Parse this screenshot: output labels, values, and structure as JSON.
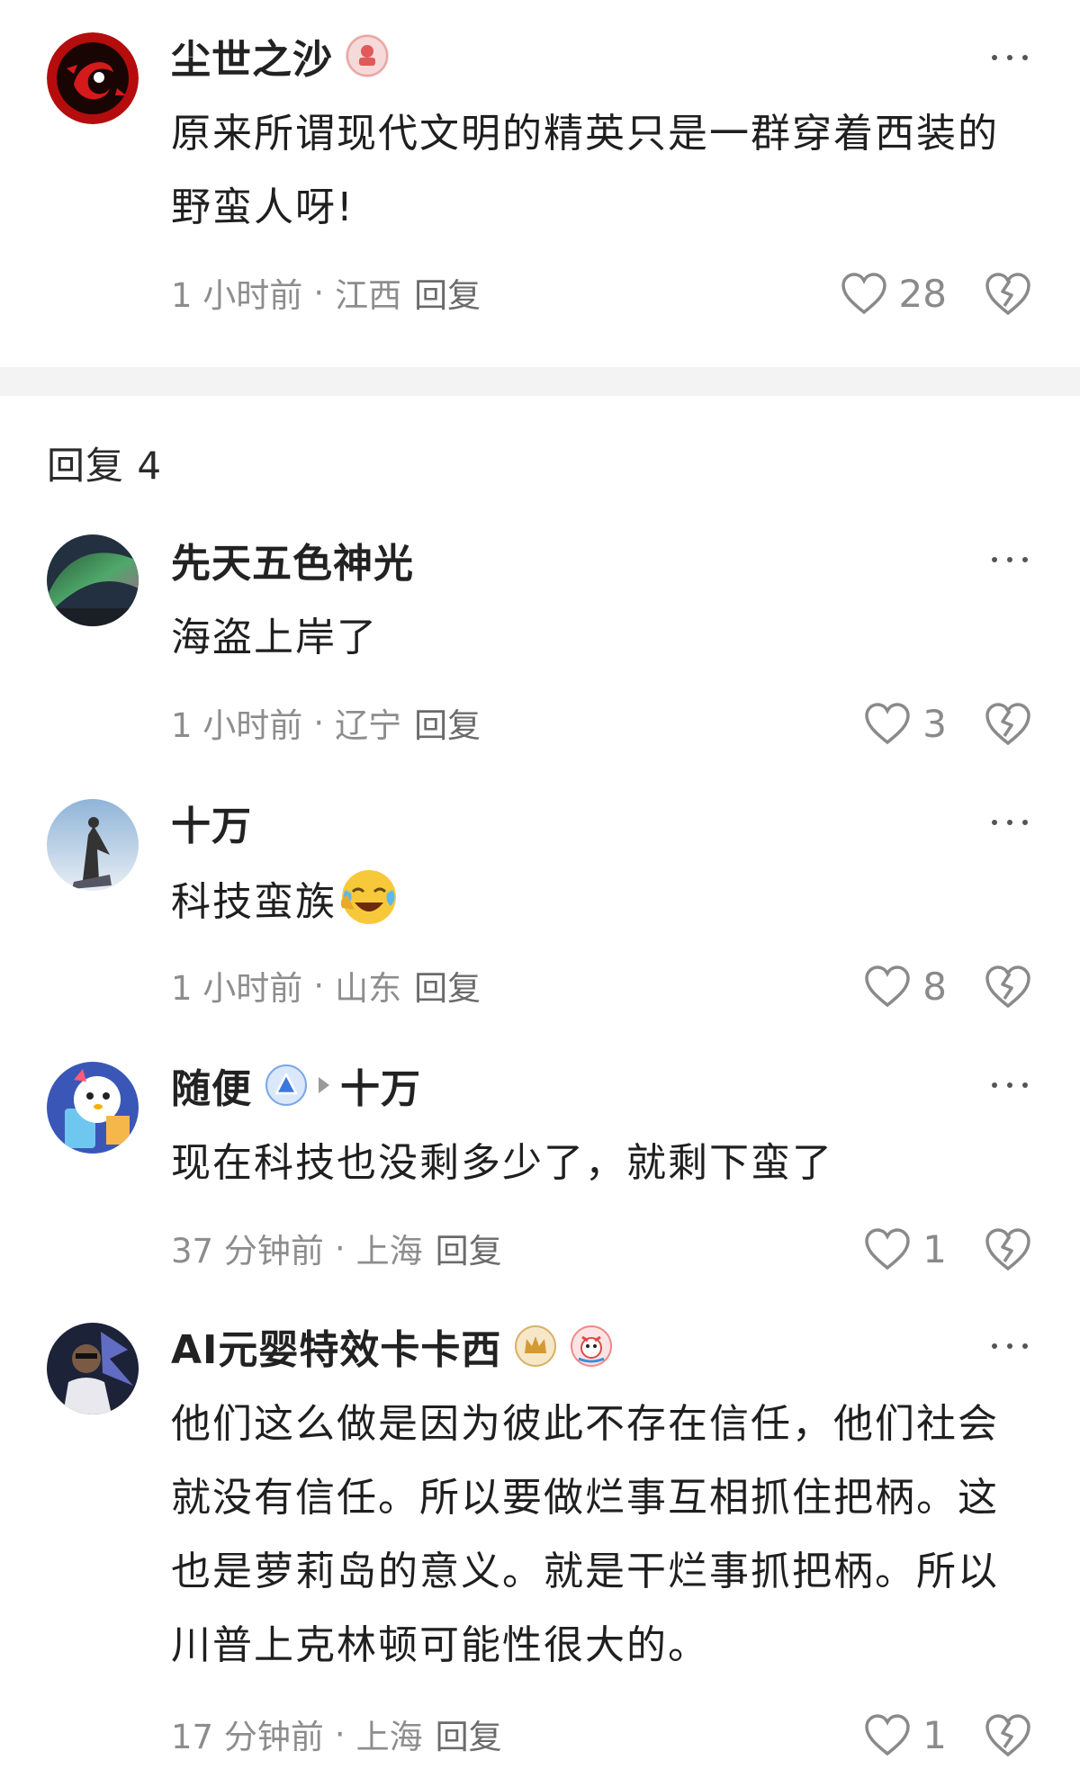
{
  "main_comment": {
    "username": "尘世之沙",
    "text": "原来所谓现代文明的精英只是一群穿着西装的野蛮人呀!",
    "time": "1 小时前",
    "location": "江西",
    "reply_label": "回复",
    "likes": "28"
  },
  "replies_header": "回复 4",
  "replies": [
    {
      "username": "先天五色神光",
      "text": "海盗上岸了",
      "time": "1 小时前",
      "location": "辽宁",
      "reply_label": "回复",
      "likes": "3"
    },
    {
      "username": "十万",
      "text": "科技蛮族",
      "time": "1 小时前",
      "location": "山东",
      "reply_label": "回复",
      "likes": "8",
      "emoji": "laughing-crying-emoji"
    },
    {
      "username": "随便",
      "reply_to": "十万",
      "text": "现在科技也没剩多少了，就剩下蛮了",
      "time": "37 分钟前",
      "location": "上海",
      "reply_label": "回复",
      "likes": "1"
    },
    {
      "username": "AI元婴特效卡卡西",
      "text": "他们这么做是因为彼此不存在信任，他们社会就没有信任。所以要做烂事互相抓住把柄。这也是萝莉岛的意义。就是干烂事抓把柄。所以川普上克林顿可能性很大的。",
      "time": "17 分钟前",
      "location": "上海",
      "reply_label": "回复",
      "likes": "1"
    }
  ],
  "separator": "·",
  "colors": {
    "text": "#1f1f1f",
    "meta": "#8d8d8d",
    "divider": "#f3f3f3",
    "icon": "#8a8a8a"
  }
}
